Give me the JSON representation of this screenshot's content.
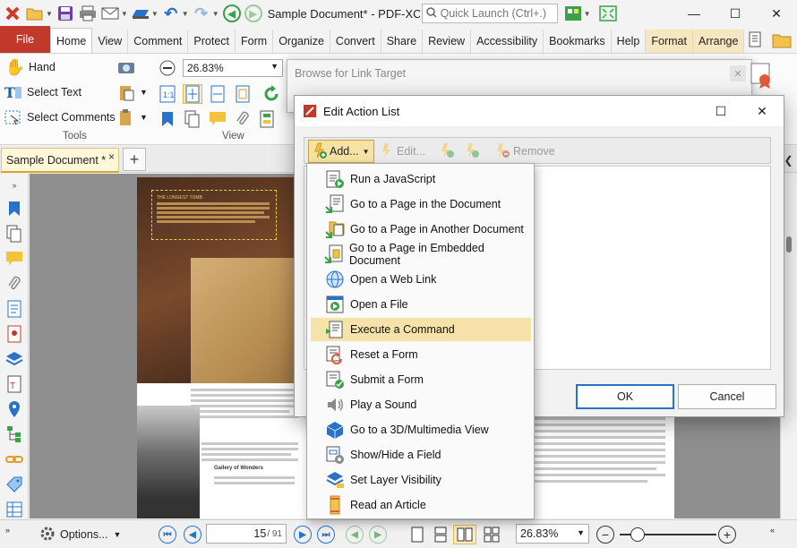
{
  "window": {
    "title": "Sample Document* - PDF-XCh...",
    "quick_launch_placeholder": "Quick Launch (Ctrl+.)",
    "minimize": "—",
    "maximize": "☐",
    "close": "✕"
  },
  "ribbon_tabs": [
    "File",
    "Home",
    "View",
    "Comment",
    "Protect",
    "Form",
    "Organize",
    "Convert",
    "Share",
    "Review",
    "Accessibility",
    "Bookmarks",
    "Help",
    "Format",
    "Arrange"
  ],
  "ribbon": {
    "hand": "Hand",
    "select_text": "Select Text",
    "select_comments": "Select Comments",
    "tools_group": "Tools",
    "view_group": "View",
    "zoom": "26.83%"
  },
  "doc_tab": {
    "label": "Sample Document *",
    "close": "×",
    "new": "+"
  },
  "page_text": {
    "heading": "THE LONGEST TOMB",
    "gallery": "Gallery of Wonders"
  },
  "status": {
    "options": "Options...",
    "current_page": "15",
    "total_pages": "/ 91",
    "zoom": "26.83%"
  },
  "browse_dialog": {
    "title": "Browse for Link Target"
  },
  "edit_dialog": {
    "title": "Edit Action List",
    "add": "Add...",
    "edit": "Edit...",
    "remove": "Remove",
    "ok": "OK",
    "cancel": "Cancel"
  },
  "action_menu": {
    "highlighted_index": 6,
    "items": [
      {
        "label": "Run a JavaScript",
        "icon": "javascript-icon"
      },
      {
        "label": "Go to a Page in the Document",
        "icon": "goto-page-icon"
      },
      {
        "label": "Go to a Page in Another Document",
        "icon": "goto-other-doc-icon"
      },
      {
        "label": "Go to a Page in Embedded Document",
        "icon": "goto-embedded-doc-icon"
      },
      {
        "label": "Open a Web Link",
        "icon": "web-link-icon"
      },
      {
        "label": "Open a File",
        "icon": "open-file-icon"
      },
      {
        "label": "Execute a Command",
        "icon": "execute-command-icon"
      },
      {
        "label": "Reset a Form",
        "icon": "reset-form-icon"
      },
      {
        "label": "Submit a Form",
        "icon": "submit-form-icon"
      },
      {
        "label": "Play a Sound",
        "icon": "play-sound-icon"
      },
      {
        "label": "Go to a 3D/Multimedia View",
        "icon": "3d-view-icon"
      },
      {
        "label": "Show/Hide a Field",
        "icon": "show-hide-field-icon"
      },
      {
        "label": "Set Layer Visibility",
        "icon": "layer-visibility-icon"
      },
      {
        "label": "Read an Article",
        "icon": "read-article-icon"
      }
    ]
  },
  "colors": {
    "file_tab": "#c0392b",
    "highlight": "#f7e3aa",
    "accent_blue": "#2a72c8",
    "context_tab": "#f6e7c1"
  }
}
